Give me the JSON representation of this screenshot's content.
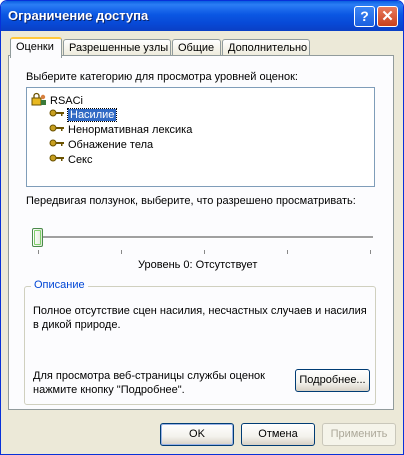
{
  "window": {
    "title": "Ограничение доступа"
  },
  "tabs": [
    {
      "label": "Оценки"
    },
    {
      "label": "Разрешенные узлы"
    },
    {
      "label": "Общие"
    },
    {
      "label": "Дополнительно"
    }
  ],
  "ratings": {
    "prompt": "Выберите категорию для просмотра уровней оценок:",
    "root": "RSACi",
    "items": [
      {
        "label": "Насилие"
      },
      {
        "label": "Ненормативная лексика"
      },
      {
        "label": "Обнажение тела"
      },
      {
        "label": "Секс"
      }
    ],
    "slider_prompt": "Передвигая ползунок, выберите, что разрешено просматривать:",
    "level_text": "Уровень 0:  Отсутствует",
    "slider_level": 0,
    "slider_max": 4
  },
  "description": {
    "group_label": "Описание",
    "text_line1": "Полное отсутствие сцен насилия, несчастных случаев и насилия",
    "text_line2": "в дикой природе.",
    "more_line1": "Для просмотра веб-страницы службы оценок",
    "more_line2": "нажмите кнопку \"Подробнее\".",
    "more_button": "Подробнее..."
  },
  "buttons": {
    "ok": "OK",
    "cancel": "Отмена",
    "apply": "Применить"
  },
  "colors": {
    "title_bar": "#0b57e3",
    "selection": "#316ac5",
    "group_label": "#0046d5"
  }
}
